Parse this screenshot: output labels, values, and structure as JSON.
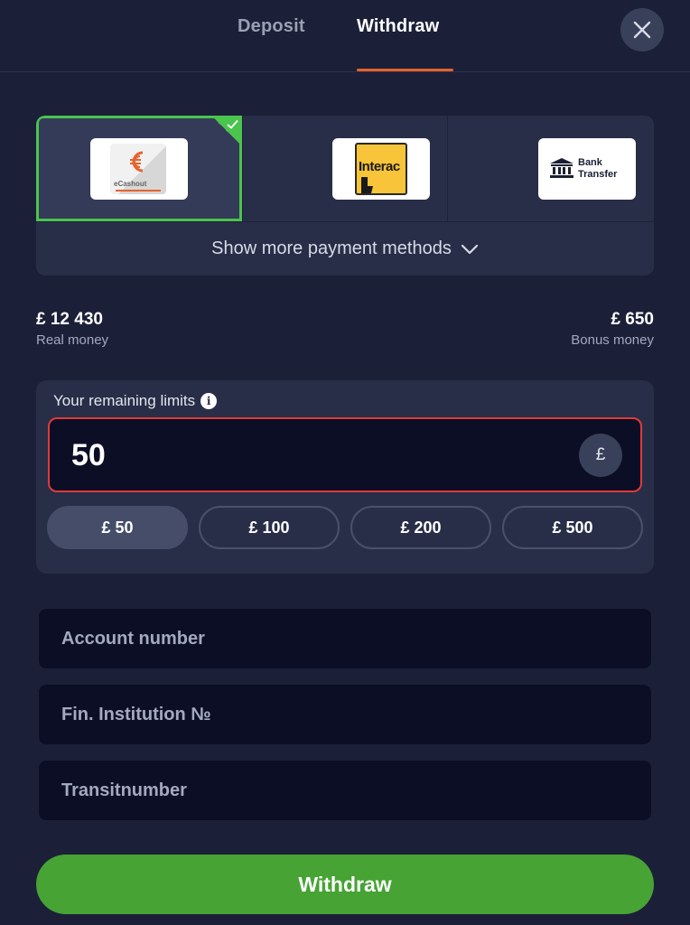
{
  "tabs": [
    {
      "label": "Deposit",
      "active": false
    },
    {
      "label": "Withdraw",
      "active": true
    }
  ],
  "icons": {
    "close": "close-icon",
    "check": "check-icon",
    "chevron": "chevron-down-icon",
    "info": "info-icon",
    "bank": "bank-icon"
  },
  "payment_methods": [
    {
      "name": "eCashout",
      "logo_text": "eCashout",
      "selected": true
    },
    {
      "name": "Interac",
      "logo_text": "Interac",
      "selected": false
    },
    {
      "name": "Bank Transfer",
      "logo_text_1": "Bank",
      "logo_text_2": "Transfer",
      "selected": false
    }
  ],
  "show_more_label": "Show more payment methods",
  "balances": {
    "real": {
      "value": "£ 12 430",
      "label": "Real money"
    },
    "bonus": {
      "value": "£ 650",
      "label": "Bonus money"
    }
  },
  "limits": {
    "title": "Your remaining limits",
    "info_glyph": "i",
    "amount_value": "50",
    "currency_symbol": "£",
    "quick_amounts": [
      "£ 50",
      "£ 100",
      "£ 200",
      "£ 500"
    ],
    "quick_selected": 0
  },
  "form": {
    "account_placeholder": "Account number",
    "institution_placeholder": "Fin. Institution №",
    "transit_placeholder": "Transitnumber"
  },
  "submit_label": "Withdraw",
  "colors": {
    "background": "#1b2038",
    "card": "#282e47",
    "accent_tab": "#e8622c",
    "selected_border": "#4bc44e",
    "error_border": "#e03a3a",
    "primary_button": "#46a334"
  }
}
